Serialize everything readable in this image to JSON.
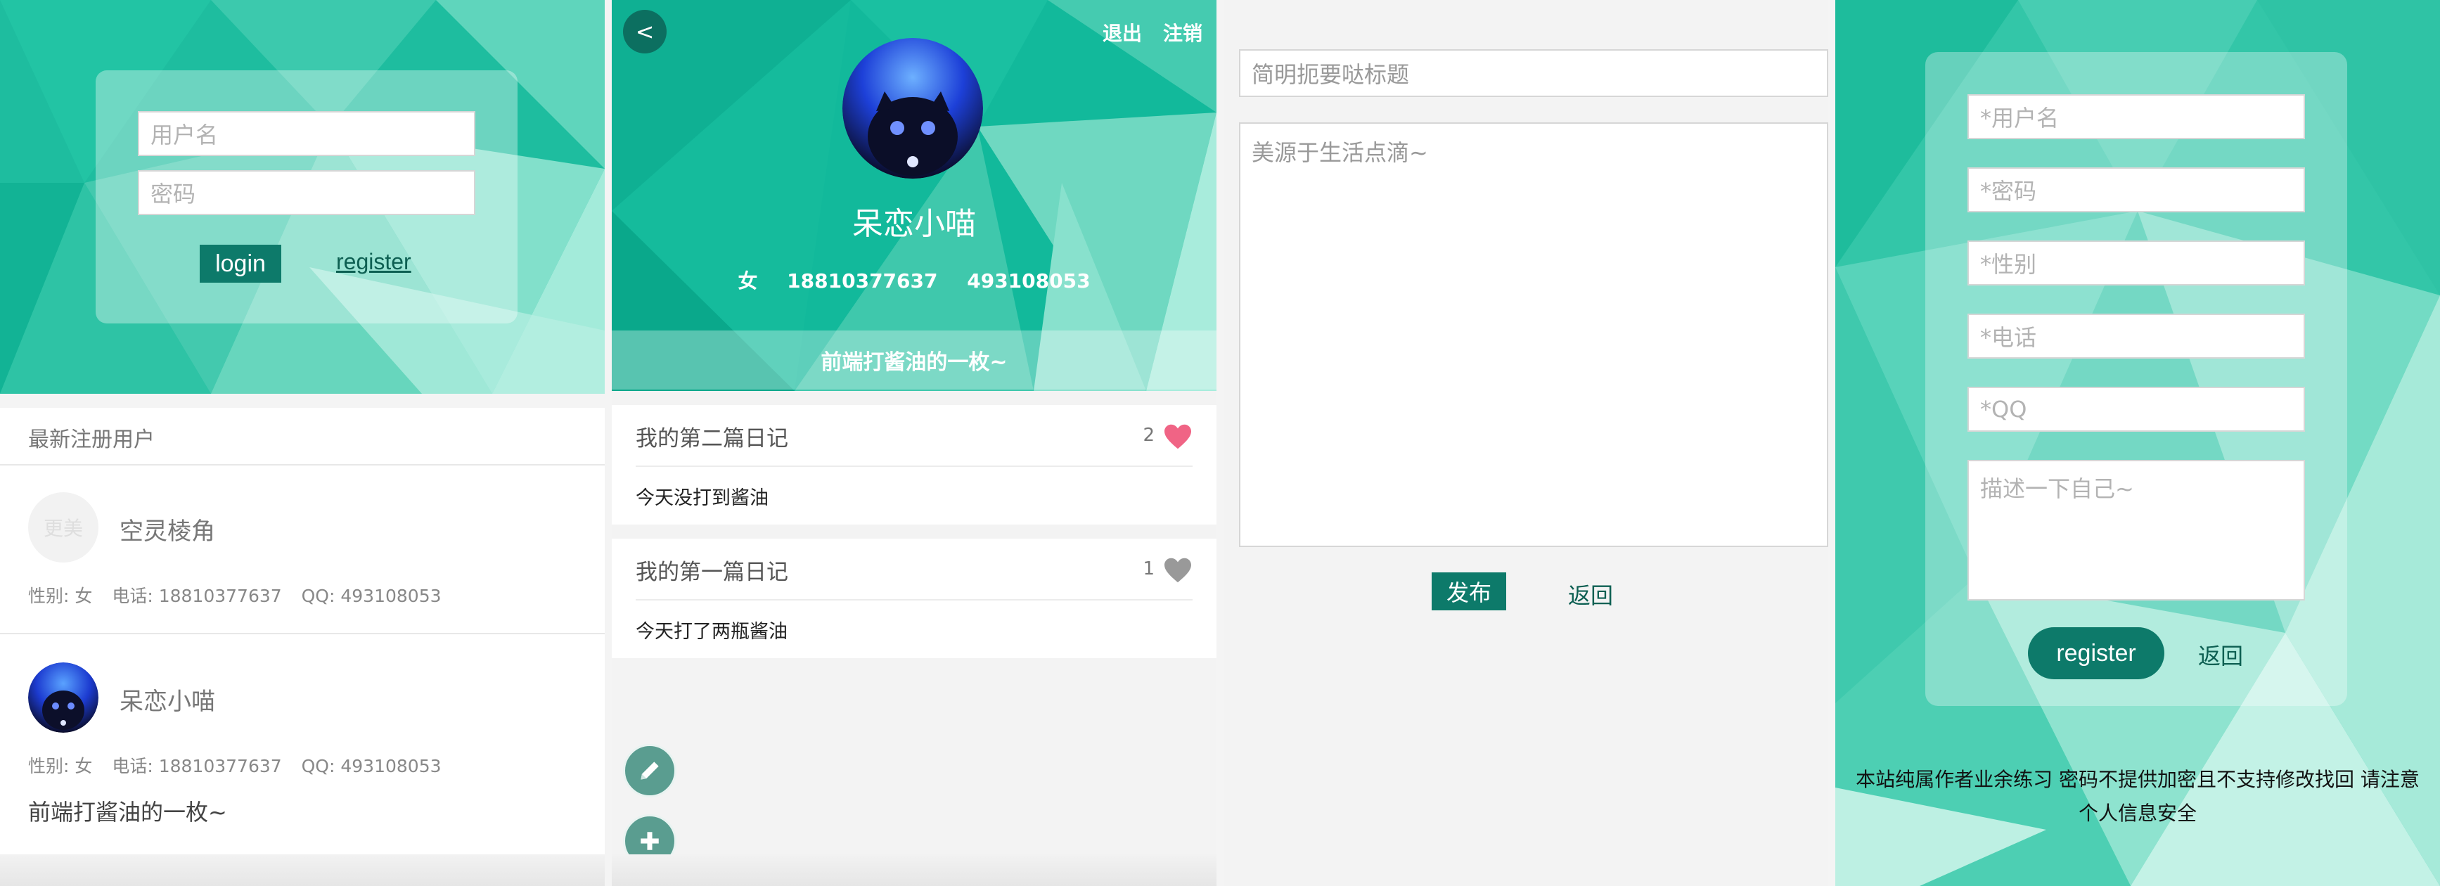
{
  "colors": {
    "teal": "#1fb99d",
    "teal_dark": "#0d7a6a",
    "heart_pink": "#f06485",
    "heart_gray": "#999999"
  },
  "login_screen": {
    "username_placeholder": "用户名",
    "password_placeholder": "密码",
    "login_button": "login",
    "register_link": "register",
    "recent_users_title": "最新注册用户",
    "users": [
      {
        "avatar_icon": "blank-avatar",
        "avatar_text": "更美",
        "name": "空灵棱角",
        "gender": "性别: 女",
        "phone": "电话: 18810377637",
        "qq": "QQ: 493108053"
      },
      {
        "avatar_icon": "cat-avatar",
        "name": "呆恋小喵",
        "gender": "性别: 女",
        "phone": "电话: 18810377637",
        "qq": "QQ: 493108053",
        "description": "前端打酱油的一枚~"
      }
    ]
  },
  "profile_screen": {
    "back_label": "<",
    "logout_label": "退出",
    "cancel_account_label": "注销",
    "avatar_icon": "cat-avatar",
    "name": "呆恋小喵",
    "gender": "女",
    "phone": "18810377637",
    "qq": "493108053",
    "motto": "前端打酱油的一枚~",
    "diaries": [
      {
        "title": "我的第二篇日记",
        "likes": "2",
        "liked": true,
        "body": "今天没打到酱油"
      },
      {
        "title": "我的第一篇日记",
        "likes": "1",
        "liked": false,
        "body": "今天打了两瓶酱油"
      }
    ],
    "fab_icons": [
      "pencil-icon",
      "plus-icon"
    ]
  },
  "editor_screen": {
    "title_placeholder": "简明扼要哒标题",
    "content_placeholder": "美源于生活点滴~",
    "publish_button": "发布",
    "back_link": "返回"
  },
  "register_screen": {
    "username_placeholder": "*用户名",
    "password_placeholder": "*密码",
    "gender_placeholder": "*性别",
    "phone_placeholder": "*电话",
    "qq_placeholder": "*QQ",
    "bio_placeholder": "描述一下自己~",
    "register_button": "register",
    "back_link": "返回",
    "notice": "本站纯属作者业余练习 密码不提供加密且不支持修改找回 请注意个人信息安全"
  }
}
